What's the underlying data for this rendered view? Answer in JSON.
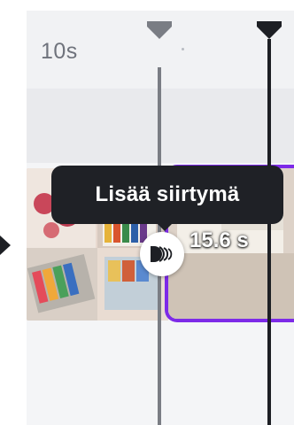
{
  "timeline": {
    "ruler_label": "10s",
    "accent_color": "#7d2ae8",
    "playhead_colors": [
      "#7a7d84",
      "#1d1f24"
    ]
  },
  "tooltip": {
    "text": "Lisää siirtymä"
  },
  "clip": {
    "duration": "15.6 s"
  },
  "icons": {
    "transition": "transition-icon",
    "playhead": "playhead-handle-icon",
    "arrow": "chevron-right-icon"
  }
}
